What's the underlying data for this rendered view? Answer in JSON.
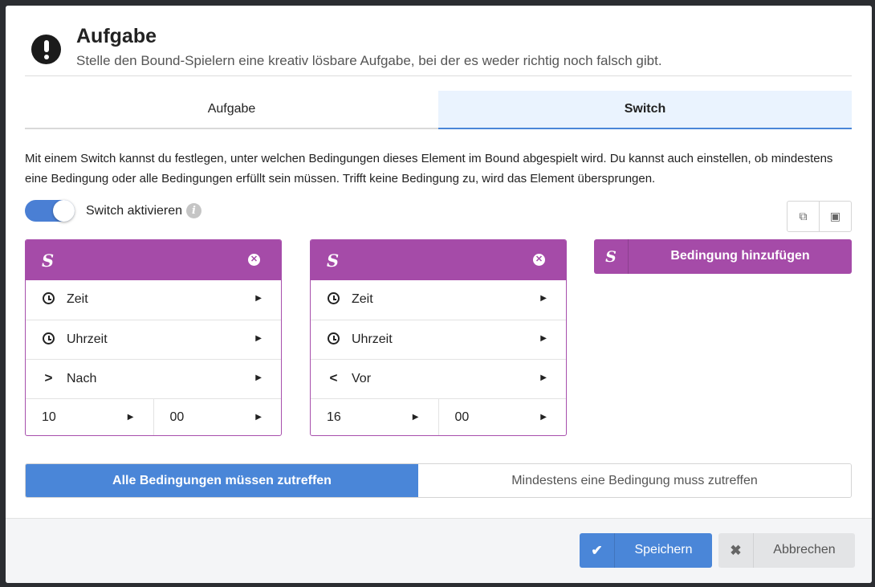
{
  "header": {
    "title": "Aufgabe",
    "subtitle": "Stelle den Bound-Spielern eine kreativ lösbare Aufgabe, bei der es weder richtig noch falsch gibt."
  },
  "tabs": [
    {
      "label": "Aufgabe",
      "active": false
    },
    {
      "label": "Switch",
      "active": true
    }
  ],
  "description": "Mit einem Switch kannst du festlegen, unter welchen Bedingungen dieses Element im Bound abgespielt wird. Du kannst auch einstellen, ob mindestens eine Bedingung oder alle Bedingungen erfüllt sein müssen. Trifft keine Bedingung zu, wird das Element übersprungen.",
  "switch": {
    "label": "Switch aktivieren",
    "enabled": true
  },
  "conditions": [
    {
      "rows": [
        {
          "icon": "clock-icon",
          "label": "Zeit"
        },
        {
          "icon": "clock-icon",
          "label": "Uhrzeit"
        },
        {
          "icon": "greater-than-icon",
          "symbol": ">",
          "label": "Nach"
        }
      ],
      "hour": "10",
      "minute": "00"
    },
    {
      "rows": [
        {
          "icon": "clock-icon",
          "label": "Zeit"
        },
        {
          "icon": "clock-icon",
          "label": "Uhrzeit"
        },
        {
          "icon": "less-than-icon",
          "symbol": "<",
          "label": "Vor"
        }
      ],
      "hour": "16",
      "minute": "00"
    }
  ],
  "add_condition_label": "Bedingung hinzufügen",
  "match_mode": {
    "all": "Alle Bedingungen müssen zutreffen",
    "any": "Mindestens eine Bedingung muss zutreffen",
    "selected": "all"
  },
  "footer": {
    "save": "Speichern",
    "cancel": "Abbrechen"
  },
  "colors": {
    "accent_blue": "#4a86d8",
    "condition_purple": "#a54ba8",
    "tab_active_bg": "#eaf3fe"
  }
}
